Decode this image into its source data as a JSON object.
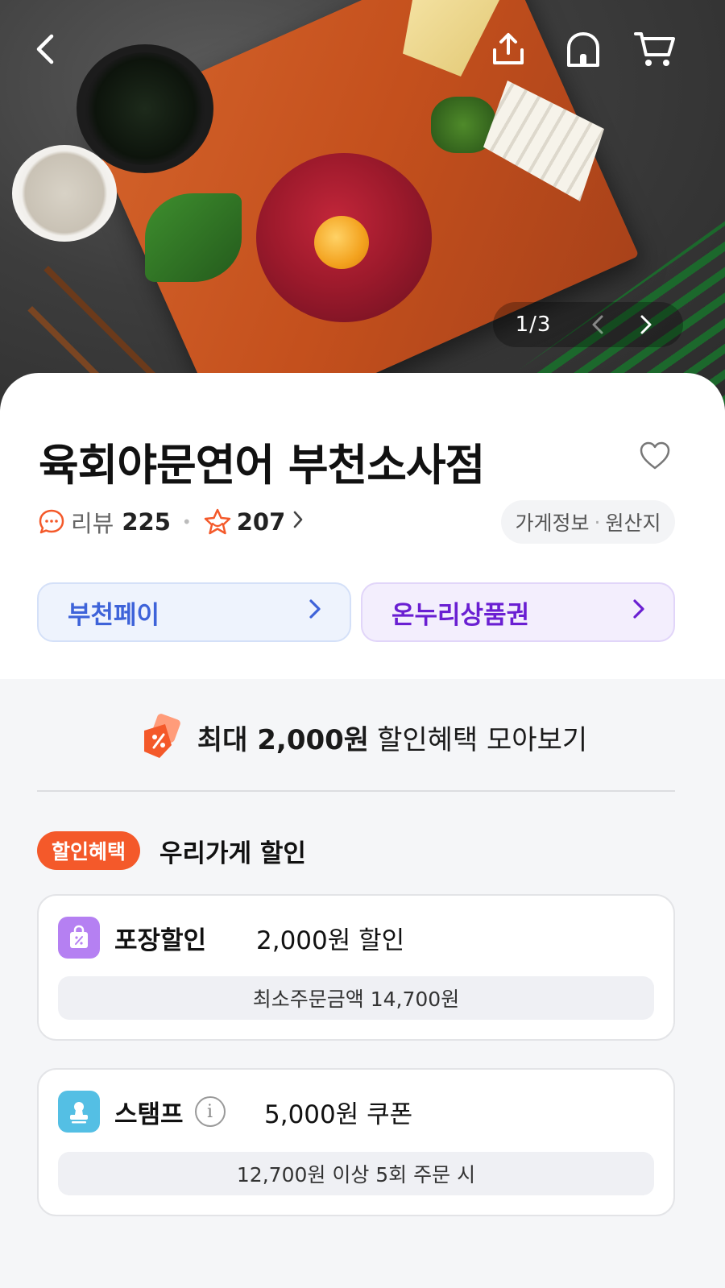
{
  "hero": {
    "page_indicator": "1/3"
  },
  "store": {
    "name": "육회야문연어 부천소사점",
    "review_label": "리뷰",
    "review_count": "225",
    "star_count": "207",
    "info_label": "가게정보",
    "origin_label": "원산지",
    "info_separator": "·"
  },
  "payments": [
    {
      "label": "부천페이",
      "color": "#3e63d9"
    },
    {
      "label": "온누리상품권",
      "color": "#6a1fd2"
    }
  ],
  "discount": {
    "banner_strong": "최대 2,000원",
    "banner_rest": "할인혜택 모아보기",
    "badge": "할인혜택",
    "section_title": "우리가게 할인",
    "items": [
      {
        "icon": "takeout-bag-icon",
        "title": "포장할인",
        "value": "2,000원 할인",
        "condition": "최소주문금액 14,700원"
      },
      {
        "icon": "stamp-icon",
        "title": "스탬프",
        "value": "5,000원 쿠폰",
        "condition": "12,700원 이상 5회 주문 시"
      }
    ]
  },
  "colors": {
    "accent_orange": "#f4592a",
    "bucheon_blue": "#3e63d9",
    "onnuri_purple": "#6a1fd2"
  }
}
